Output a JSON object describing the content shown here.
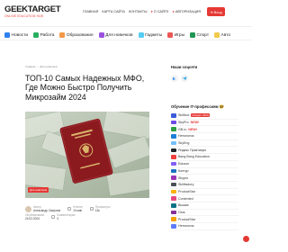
{
  "header": {
    "logo": "GEEKTARGET",
    "logo_sub": "ONLINE EDUCATION HUB",
    "nav": [
      "Главная",
      "Карта сайта",
      "Контакты",
      "О сайте",
      "Авторизация"
    ],
    "login_label": "Вход"
  },
  "categories": [
    {
      "label": "Новости",
      "color": "#2f80ed"
    },
    {
      "label": "Работа",
      "color": "#27ae60"
    },
    {
      "label": "Образование",
      "color": "#f2994a"
    },
    {
      "label": "Для новичков",
      "color": "#9b51e0"
    },
    {
      "label": "Гаджеты",
      "color": "#56ccf2"
    },
    {
      "label": "Игры",
      "color": "#eb5757"
    },
    {
      "label": "Спорт",
      "color": "#219653"
    },
    {
      "label": "Авто",
      "color": "#f2c94c"
    }
  ],
  "breadcrumb": [
    "Главная",
    "›",
    "Для новичков"
  ],
  "article": {
    "title": "ТОП-10 Самых Надежных МФО, Где Можно Быстро Получить Микрозайм 2024",
    "badge": "Для новичков",
    "author_label": "Автор",
    "author": "Александр Смирнов",
    "published_label": "Опубликовано",
    "published": "24.02.2024",
    "read_label": "Чтение",
    "read": "10 мин",
    "comments_label": "Комментарии",
    "comments": "0",
    "views_label": "Просмотры",
    "views": "13к"
  },
  "sidebar": {
    "social_title": "Наши соцсети",
    "edu_title": "Обучение IT-профессиям 🤓",
    "courses": [
      {
        "name": "Skillbox",
        "tag": "(Скидки -60%)",
        "color": "#3b5bdb"
      },
      {
        "name": "SkyPro",
        "new": "NEW!",
        "color": "#7048e8"
      },
      {
        "name": "GB.ru",
        "new": "NEW!",
        "color": "#2f9e44"
      },
      {
        "name": "Нетология",
        "color": "#1c7ed6"
      },
      {
        "name": "SkyEng",
        "color": "#74c0fc"
      },
      {
        "name": "Яндекс Практикум",
        "color": "#212529"
      },
      {
        "name": "Bang Bang Education",
        "color": "#f03e3e"
      },
      {
        "name": "Eduson",
        "color": "#845ef7"
      },
      {
        "name": "Контур",
        "color": "#1971c2"
      },
      {
        "name": "Skypro",
        "color": "#9c36b5"
      },
      {
        "name": "Skillfactory",
        "color": "#495057"
      },
      {
        "name": "ProductStar",
        "color": "#fab005"
      },
      {
        "name": "Contented",
        "color": "#e64980"
      },
      {
        "name": "Вышка",
        "color": "#0b7285"
      },
      {
        "name": "Otus",
        "color": "#862e9c"
      },
      {
        "name": "ProductStar",
        "color": "#f59f00"
      },
      {
        "name": "Нетология",
        "color": "#5c7cfa"
      }
    ]
  }
}
